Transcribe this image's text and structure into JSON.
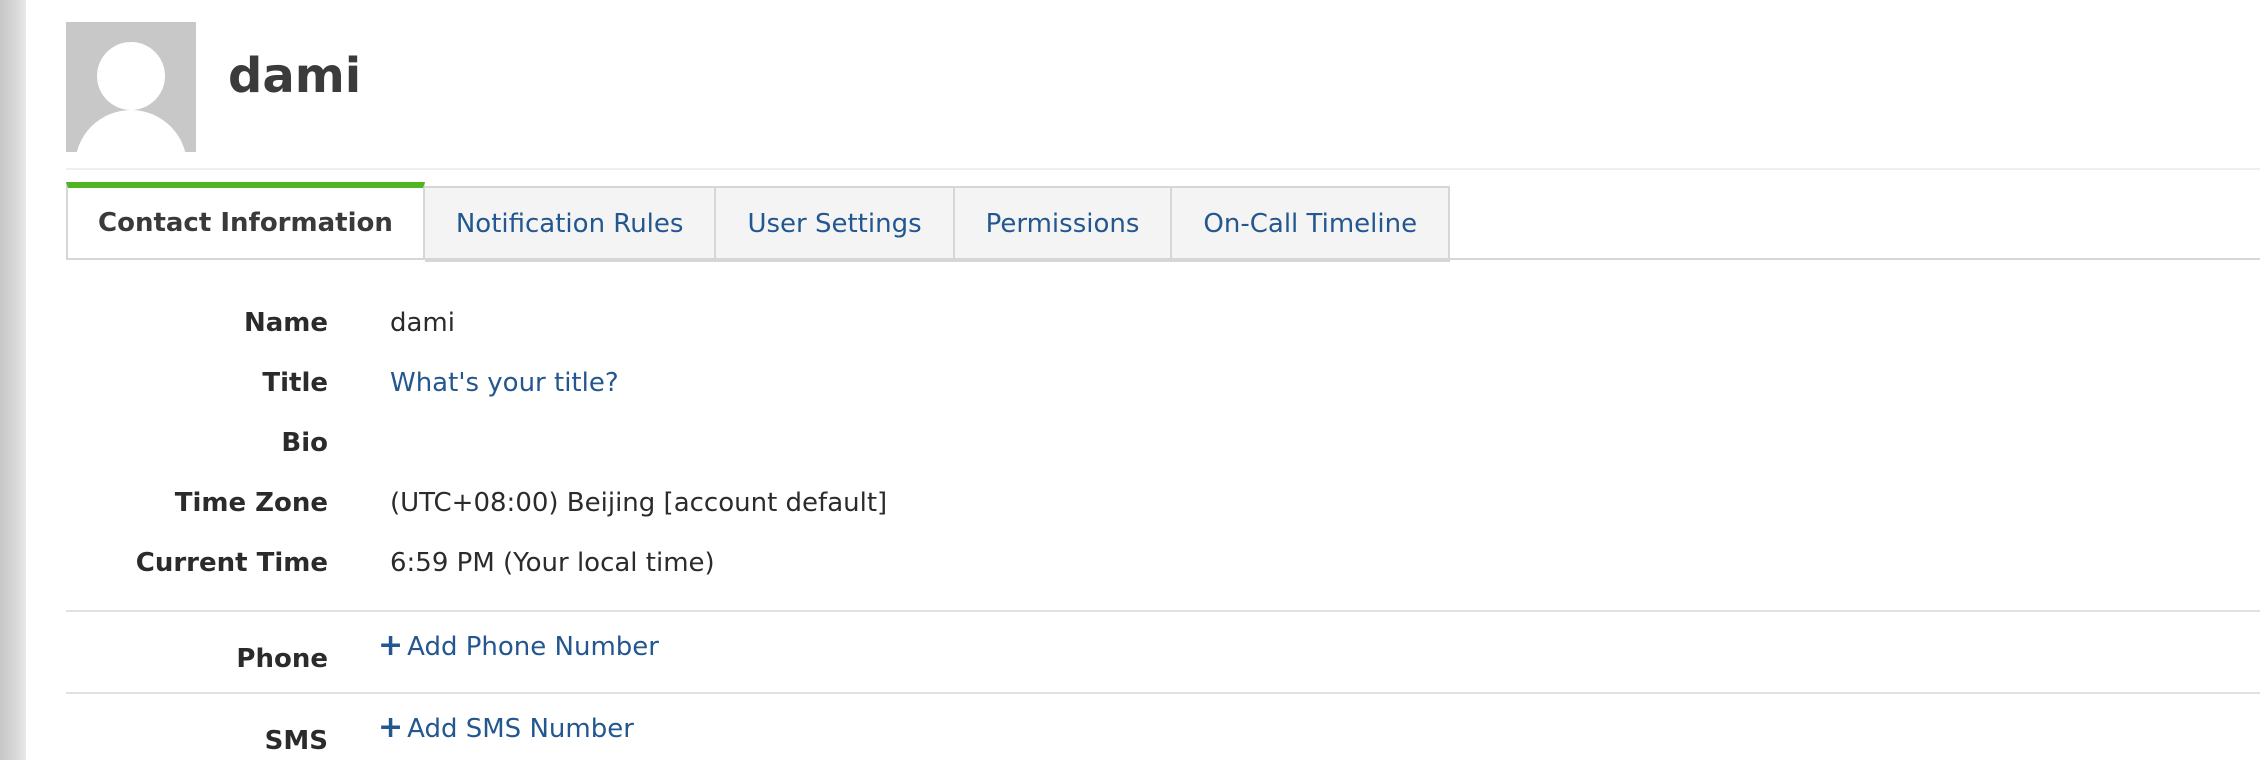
{
  "user": {
    "name": "dami"
  },
  "tabs": [
    {
      "label": "Contact Information",
      "active": true
    },
    {
      "label": "Notification Rules",
      "active": false
    },
    {
      "label": "User Settings",
      "active": false
    },
    {
      "label": "Permissions",
      "active": false
    },
    {
      "label": "On-Call Timeline",
      "active": false
    }
  ],
  "contact": {
    "name": {
      "label": "Name",
      "value": "dami"
    },
    "title": {
      "label": "Title",
      "value": "What's your title?"
    },
    "bio": {
      "label": "Bio",
      "value": ""
    },
    "time_zone": {
      "label": "Time Zone",
      "value": "(UTC+08:00) Beijing [account default]"
    },
    "current_time": {
      "label": "Current Time",
      "value": "6:59 PM (Your local time)"
    }
  },
  "phone": {
    "label": "Phone",
    "add_label": "Add Phone Number"
  },
  "sms": {
    "label": "SMS",
    "add_label": "Add SMS Number"
  },
  "colors": {
    "accent_green": "#4fb521",
    "link_blue": "#24578f",
    "tab_bg": "#f4f4f4"
  },
  "icons": {
    "edit": "edit-icon",
    "add": "plus-icon",
    "avatar": "default-avatar"
  }
}
